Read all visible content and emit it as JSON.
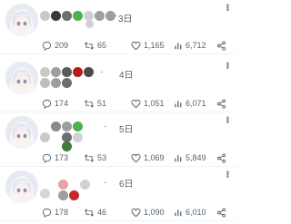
{
  "colors": {
    "text_secondary": "#536471",
    "divider": "#eff3f4",
    "icon": "#536471"
  },
  "icons": {
    "reply": "reply-icon",
    "retweet": "retweet-icon",
    "like": "heart-icon",
    "views": "views-icon",
    "share": "share-icon",
    "more": "more-icon"
  },
  "posts": [
    {
      "separator": "·",
      "date": "3日",
      "name_dots": [
        "#c9c9c9",
        "#3a3a3a",
        "#6e6e6e",
        "#4caf50",
        "#cfd2d4",
        "#9e9e9e",
        "#9aa0a3",
        "#cfd2d4"
      ],
      "replies": "209",
      "retweets": "65",
      "likes": "1,165",
      "views": "6,712"
    },
    {
      "separator": "·",
      "date": "4日",
      "name_dots": [
        "#c9c9c9",
        "#9e9e9e",
        "#5a5a5a",
        "#b71c1c",
        "#4a4a4a",
        "#bdbdbd",
        "#9e9e9e",
        "#6e6e6e"
      ],
      "replies": "174",
      "retweets": "51",
      "likes": "1,051",
      "views": "6,071"
    },
    {
      "separator": "·",
      "date": "5日",
      "name_dots": [
        "#c9c9c9",
        "#8a8a8a",
        "#9e9e9e",
        "#4caf50",
        "#cfd2d4",
        "#6e6e6e",
        "#3f7d3a"
      ],
      "replies": "173",
      "retweets": "53",
      "likes": "1,069",
      "views": "5,849"
    },
    {
      "separator": "·",
      "date": "6日",
      "name_dots": [
        "#d6d6d6",
        "#e6a3a8",
        "#9e9e9e",
        "#c62828",
        "#cfd2d4"
      ],
      "replies": "178",
      "retweets": "46",
      "likes": "1,090",
      "views": "6,010"
    }
  ]
}
